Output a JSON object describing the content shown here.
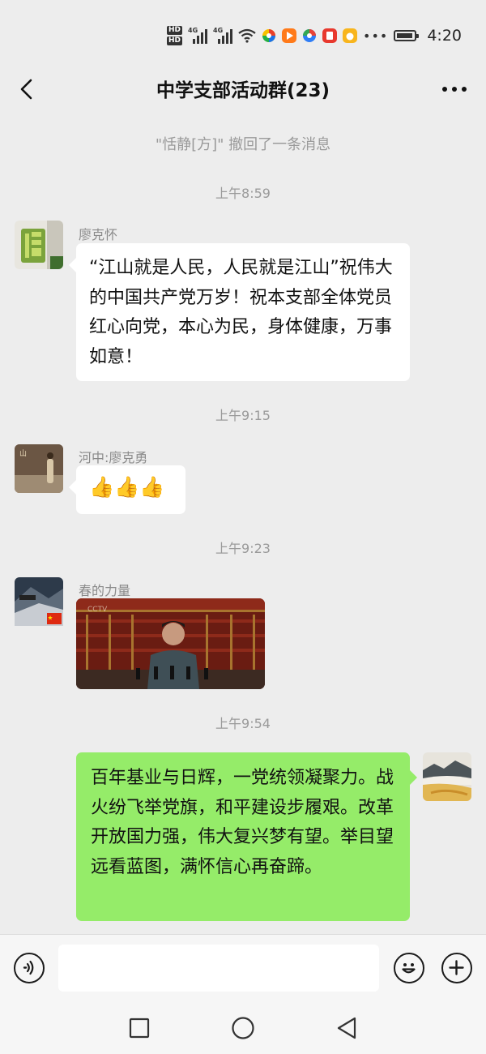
{
  "status_bar": {
    "time": "4:20",
    "hd_labels": [
      "HD",
      "HD"
    ],
    "network_labels": [
      "4G",
      "4G"
    ],
    "icons": [
      "wifi-icon",
      "app-icon",
      "video-app-icon",
      "app-icon",
      "red-app-icon",
      "yellow-app-icon",
      "more-dots",
      "battery-icon"
    ]
  },
  "header": {
    "title": "中学支部活动群(23)",
    "back_icon": "chevron-left-icon",
    "more_icon": "more-icon"
  },
  "chat": {
    "recall_notice": "\"恬静[方]\" 撤回了一条消息",
    "messages": [
      {
        "time": "上午8:59",
        "sender": "廖克怀",
        "text": "“江山就是人民，人民就是江山”祝伟大的中国共产党万岁！祝本支部全体党员红心向党，本心为民，身体健康，万事如意！"
      },
      {
        "time": "上午9:15",
        "sender": "河中:廖克勇",
        "text": "👍👍👍"
      },
      {
        "time": "上午9:23",
        "sender": "春的力量",
        "image": "photo"
      },
      {
        "time": "上午9:54",
        "sender": "",
        "text": "百年基业与日辉，一党统领凝聚力。战火纷飞举党旗，和平建设步履艰。改革开放国力强，伟大复兴梦有望。举目望远看蓝图，满怀信心再奋蹄。"
      }
    ]
  },
  "input_bar": {
    "voice_icon": "voice-icon",
    "text_value": "",
    "emoji_icon": "emoji-icon",
    "plus_icon": "plus-icon"
  },
  "colors": {
    "background": "#ededed",
    "outgoing_bubble": "#95ec69",
    "incoming_bubble": "#ffffff",
    "meta_text": "#9a9a9a"
  }
}
